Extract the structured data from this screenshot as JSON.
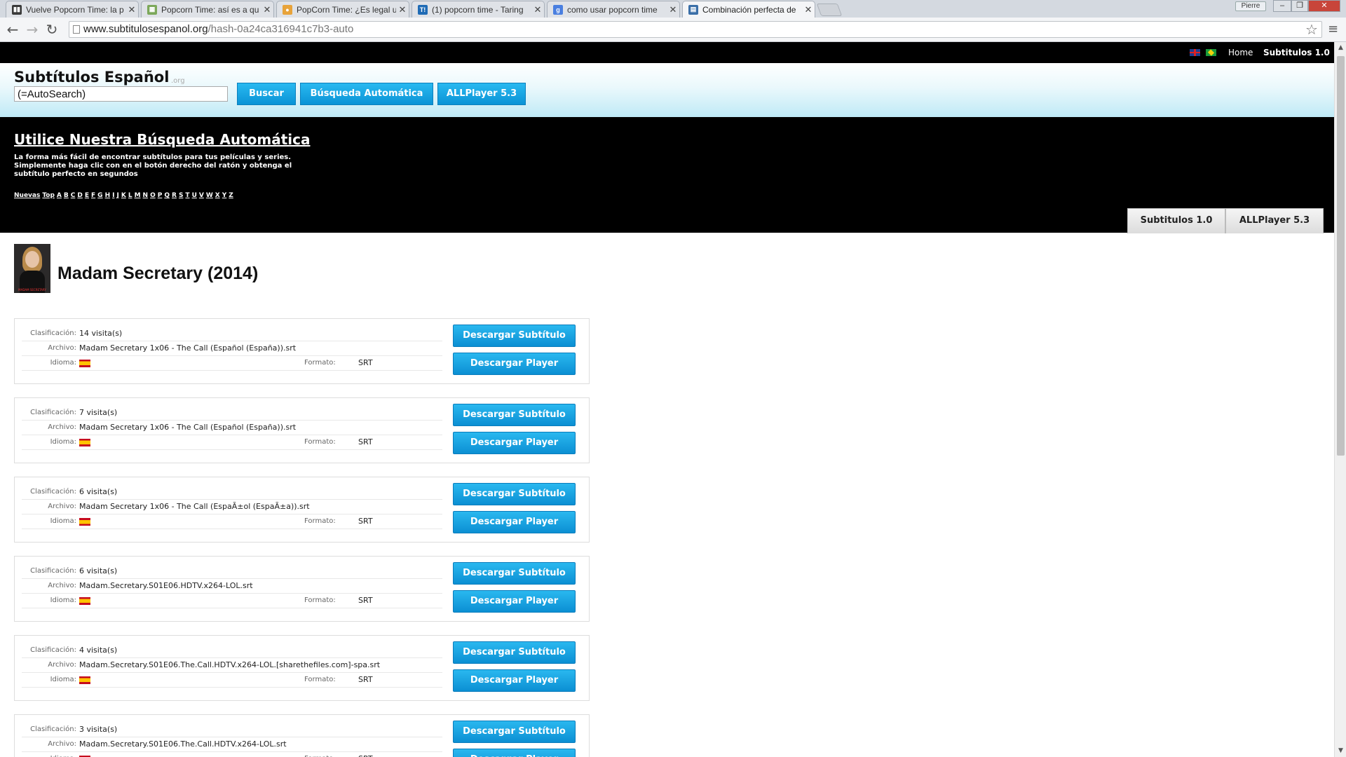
{
  "browser": {
    "tabs": [
      {
        "label": "Vuelve Popcorn Time: la p",
        "icon": "film-icon"
      },
      {
        "label": "Popcorn Time: así es a qu",
        "icon": "page-icon"
      },
      {
        "label": "PopCorn Time: ¿Es legal u",
        "icon": "popcorn-icon"
      },
      {
        "label": "(1) popcorn time - Taring",
        "icon": "taringa-icon"
      },
      {
        "label": "como usar popcorn time",
        "icon": "google-icon"
      },
      {
        "label": "Combinación perfecta de",
        "icon": "site-icon"
      }
    ],
    "user": "Pierre",
    "url_domain": "www.subtitulosespanol.org",
    "url_path": "/hash-0a24ca316941c7b3-auto"
  },
  "topnav": {
    "home": "Home",
    "subtitulos": "Subtitulos 1.0"
  },
  "header": {
    "logo": "Subtítulos Español",
    "logo_suffix": ".org",
    "search_value": "(=AutoSearch)",
    "buttons": [
      "Buscar",
      "Búsqueda Automática",
      "ALLPlayer 5.3"
    ]
  },
  "promo": {
    "title": "Utilice Nuestra Búsqueda Automática",
    "desc": "La forma más fácil de encontrar subtítulos para tus películas y series. Simplemente haga clic con en el botón derecho del ratón y obtenga el subtítulo perfecto en segundos",
    "alpha": [
      "Nuevas",
      "Top",
      "A",
      "B",
      "C",
      "D",
      "E",
      "F",
      "G",
      "H",
      "I",
      "J",
      "K",
      "L",
      "M",
      "N",
      "O",
      "P",
      "Q",
      "R",
      "S",
      "T",
      "U",
      "V",
      "W",
      "X",
      "Y",
      "Z"
    ],
    "tabs": [
      "Subtitulos 1.0",
      "ALLPlayer 5.3"
    ]
  },
  "show": {
    "title": "Madam Secretary (2014)",
    "poster_caption": "MADAM SECRETARY"
  },
  "labels": {
    "rating": "Clasificación:",
    "file": "Archivo:",
    "language": "Idioma:",
    "format": "Formato:",
    "download_sub": "Descargar Subtítulo",
    "download_player": "Descargar Player"
  },
  "subtitles": [
    {
      "visits": "14 visita(s)",
      "file": "Madam Secretary 1x06 - The Call (Español (España)).srt",
      "format": "SRT"
    },
    {
      "visits": "7 visita(s)",
      "file": "Madam Secretary 1x06 - The Call (Español (España)).srt",
      "format": "SRT"
    },
    {
      "visits": "6 visita(s)",
      "file": "Madam Secretary 1x06 - The Call (EspaÃ±ol (EspaÃ±a)).srt",
      "format": "SRT"
    },
    {
      "visits": "6 visita(s)",
      "file": "Madam.Secretary.S01E06.HDTV.x264-LOL.srt",
      "format": "SRT"
    },
    {
      "visits": "4 visita(s)",
      "file": "Madam.Secretary.S01E06.The.Call.HDTV.x264-LOL.[sharethefiles.com]-spa.srt",
      "format": "SRT"
    },
    {
      "visits": "3 visita(s)",
      "file": "Madam.Secretary.S01E06.The.Call.HDTV.x264-LOL.srt",
      "format": "SRT"
    }
  ],
  "colors": {
    "button_blue": "#0b8fd3",
    "header_gradient_end": "#bfeaf6",
    "promo_bg": "#000000"
  }
}
